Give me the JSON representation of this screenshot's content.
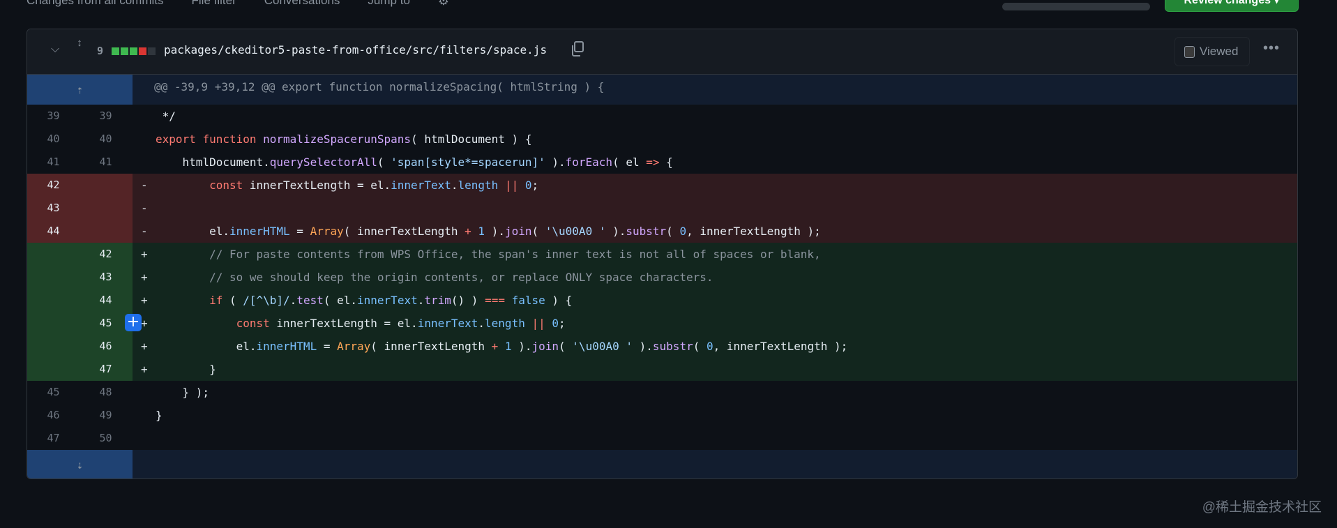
{
  "topnav": {
    "items": [
      "Changes from all commits",
      "File filter",
      "Conversations",
      "Jump to"
    ],
    "review_label": "Review changes ▾"
  },
  "file": {
    "change_count": "9",
    "diffstat": [
      "add",
      "add",
      "add",
      "del",
      "neutral"
    ],
    "path": "packages/ckeditor5-paste-from-office/src/filters/space.js",
    "viewed_label": "Viewed",
    "more": "•••"
  },
  "hunk_header": "@@ -39,9 +39,12 @@ export function normalizeSpacing( htmlString ) {",
  "colors": {
    "add": "#3fb950",
    "del": "#da3633",
    "neutral": "#30363d"
  },
  "lines": [
    {
      "type": "ctx",
      "old": "39",
      "new": "39",
      "tokens": [
        [
          "tx",
          " */"
        ]
      ]
    },
    {
      "type": "ctx",
      "old": "40",
      "new": "40",
      "tokens": [
        [
          "kw",
          "export"
        ],
        [
          "tx",
          " "
        ],
        [
          "kw",
          "function"
        ],
        [
          "tx",
          " "
        ],
        [
          "fn",
          "normalizeSpacerunSpans"
        ],
        [
          "tx",
          "( htmlDocument ) {"
        ]
      ]
    },
    {
      "type": "ctx",
      "old": "41",
      "new": "41",
      "tokens": [
        [
          "tx",
          "    htmlDocument."
        ],
        [
          "fn",
          "querySelectorAll"
        ],
        [
          "tx",
          "( "
        ],
        [
          "st",
          "'span[style*=spacerun]'"
        ],
        [
          "tx",
          " )."
        ],
        [
          "fn",
          "forEach"
        ],
        [
          "tx",
          "( el "
        ],
        [
          "kw",
          "=>"
        ],
        [
          "tx",
          " {"
        ]
      ]
    },
    {
      "type": "del",
      "old": "42",
      "new": "",
      "tokens": [
        [
          "tx",
          "        "
        ],
        [
          "kw",
          "const"
        ],
        [
          "tx",
          " innerTextLength = el."
        ],
        [
          "pr",
          "innerText"
        ],
        [
          "tx",
          "."
        ],
        [
          "pr",
          "length"
        ],
        [
          "tx",
          " "
        ],
        [
          "kw",
          "||"
        ],
        [
          "tx",
          " "
        ],
        [
          "pr",
          "0"
        ],
        [
          "tx",
          ";"
        ]
      ]
    },
    {
      "type": "del",
      "old": "43",
      "new": "",
      "tokens": []
    },
    {
      "type": "del",
      "old": "44",
      "new": "",
      "tokens": [
        [
          "tx",
          "        el."
        ],
        [
          "pr",
          "innerHTML"
        ],
        [
          "tx",
          " = "
        ],
        [
          "cl",
          "Array"
        ],
        [
          "tx",
          "( innerTextLength "
        ],
        [
          "kw",
          "+"
        ],
        [
          "tx",
          " "
        ],
        [
          "pr",
          "1"
        ],
        [
          "tx",
          " )."
        ],
        [
          "fn",
          "join"
        ],
        [
          "tx",
          "( "
        ],
        [
          "st",
          "'\\u00A0 '"
        ],
        [
          "tx",
          " )."
        ],
        [
          "fn",
          "substr"
        ],
        [
          "tx",
          "( "
        ],
        [
          "pr",
          "0"
        ],
        [
          "tx",
          ", innerTextLength );"
        ]
      ]
    },
    {
      "type": "add",
      "old": "",
      "new": "42",
      "tokens": [
        [
          "cm",
          "        // For paste contents from WPS Office, the span's inner text is not all of spaces or blank,"
        ]
      ]
    },
    {
      "type": "add",
      "old": "",
      "new": "43",
      "tokens": [
        [
          "cm",
          "        // so we should keep the origin contents, or replace ONLY space characters."
        ]
      ]
    },
    {
      "type": "add",
      "old": "",
      "new": "44",
      "tokens": [
        [
          "tx",
          "        "
        ],
        [
          "kw",
          "if"
        ],
        [
          "tx",
          " ( "
        ],
        [
          "st",
          "/[^\\b]/"
        ],
        [
          "tx",
          "."
        ],
        [
          "fn",
          "test"
        ],
        [
          "tx",
          "( el."
        ],
        [
          "pr",
          "innerText"
        ],
        [
          "tx",
          "."
        ],
        [
          "fn",
          "trim"
        ],
        [
          "tx",
          "() ) "
        ],
        [
          "kw",
          "==="
        ],
        [
          "tx",
          " "
        ],
        [
          "pr",
          "false"
        ],
        [
          "tx",
          " ) {"
        ]
      ]
    },
    {
      "type": "add",
      "old": "",
      "new": "45",
      "tokens": [
        [
          "tx",
          "            "
        ],
        [
          "kw",
          "const"
        ],
        [
          "tx",
          " innerTextLength = el."
        ],
        [
          "pr",
          "innerText"
        ],
        [
          "tx",
          "."
        ],
        [
          "pr",
          "length"
        ],
        [
          "tx",
          " "
        ],
        [
          "kw",
          "||"
        ],
        [
          "tx",
          " "
        ],
        [
          "pr",
          "0"
        ],
        [
          "tx",
          ";"
        ]
      ]
    },
    {
      "type": "add",
      "old": "",
      "new": "46",
      "tokens": [
        [
          "tx",
          "            el."
        ],
        [
          "pr",
          "innerHTML"
        ],
        [
          "tx",
          " = "
        ],
        [
          "cl",
          "Array"
        ],
        [
          "tx",
          "( innerTextLength "
        ],
        [
          "kw",
          "+"
        ],
        [
          "tx",
          " "
        ],
        [
          "pr",
          "1"
        ],
        [
          "tx",
          " )."
        ],
        [
          "fn",
          "join"
        ],
        [
          "tx",
          "( "
        ],
        [
          "st",
          "'\\u00A0 '"
        ],
        [
          "tx",
          " )."
        ],
        [
          "fn",
          "substr"
        ],
        [
          "tx",
          "( "
        ],
        [
          "pr",
          "0"
        ],
        [
          "tx",
          ", innerTextLength );"
        ]
      ]
    },
    {
      "type": "add",
      "old": "",
      "new": "47",
      "tokens": [
        [
          "tx",
          "        }"
        ]
      ]
    },
    {
      "type": "ctx",
      "old": "45",
      "new": "48",
      "tokens": [
        [
          "tx",
          "    } );"
        ]
      ]
    },
    {
      "type": "ctx",
      "old": "46",
      "new": "49",
      "tokens": [
        [
          "tx",
          "}"
        ]
      ]
    },
    {
      "type": "ctx",
      "old": "47",
      "new": "50",
      "tokens": []
    }
  ],
  "add_comment_symbol": "+",
  "watermark": "@稀土掘金技术社区"
}
